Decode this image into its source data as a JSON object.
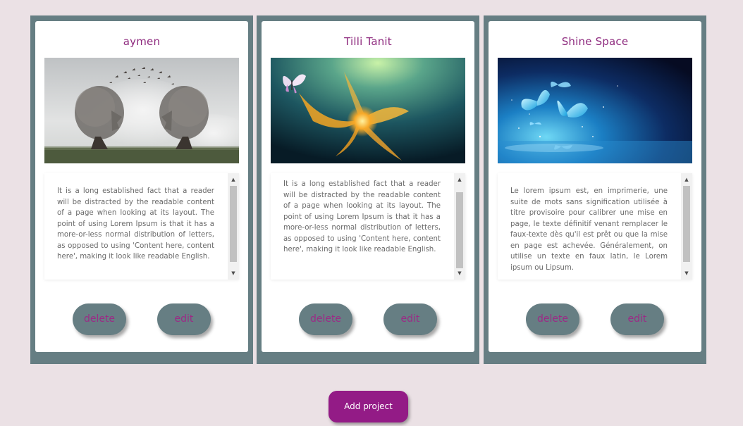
{
  "projects": [
    {
      "title": "aymen",
      "image": "trees-shaped-heads-birds",
      "description": "It is a long established fact that a reader will be distracted by the readable content of a page when looking at its layout. The point of using Lorem Ipsum is that it has a more-or-less normal distribution of letters, as opposed to using 'Content here, content here', making it look like readable English.",
      "delete_label": "delete",
      "edit_label": "edit"
    },
    {
      "title": "Tilli Tanit",
      "image": "glowing-flower-butterfly",
      "description": "It is a long established fact that a reader will be distracted by the readable content of a page when looking at its layout. The point of using Lorem Ipsum is that it has a more-or-less normal distribution of letters, as opposed to using 'Content here, content here', making it look like readable English.",
      "delete_label": "delete",
      "edit_label": "edit"
    },
    {
      "title": "Shine Space",
      "image": "blue-butterflies-water",
      "description": "Le lorem ipsum est, en imprimerie, une suite de mots sans signification utilisée à titre provisoire pour calibrer une mise en page, le texte définitif venant remplacer le faux-texte dès qu'il est prêt ou que la mise en page est achevée. Généralement, on utilise un texte en faux latin, le Lorem ipsum ou Lipsum.",
      "delete_label": "delete",
      "edit_label": "edit"
    }
  ],
  "add_project_label": "Add project",
  "colors": {
    "background": "#ebe1e5",
    "card_frame": "#667e83",
    "title": "#8e2a7e",
    "button_text": "#9b2b86",
    "add_button": "#931b86"
  }
}
